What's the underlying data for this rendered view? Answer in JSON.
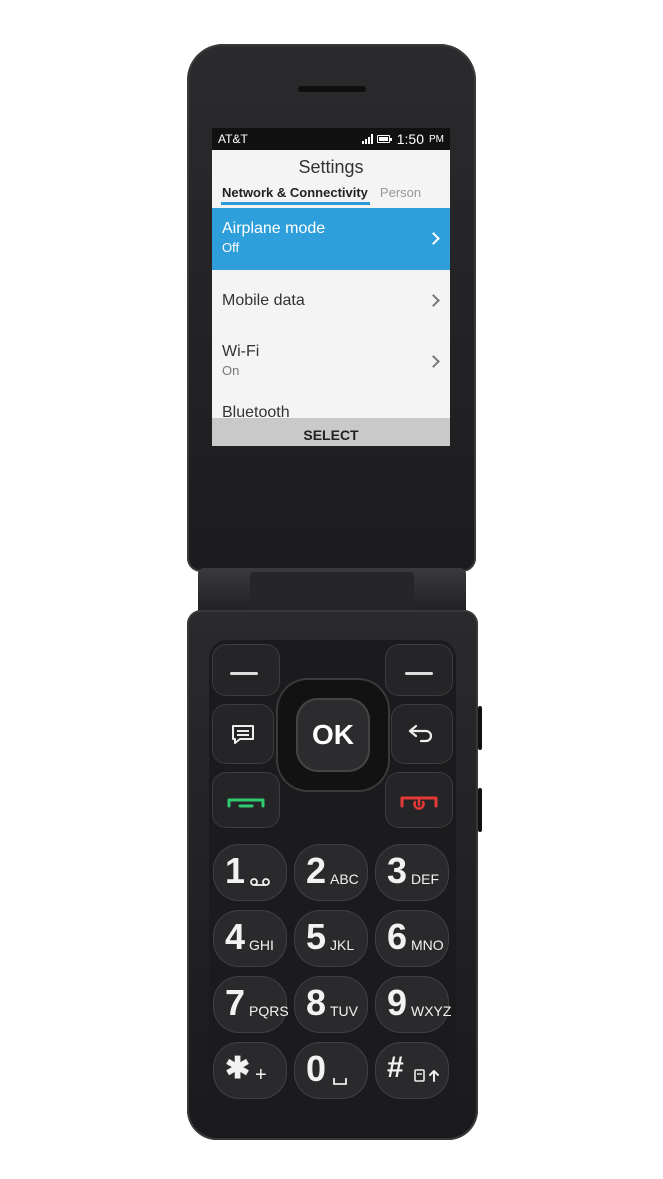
{
  "status_bar": {
    "carrier": "AT&T",
    "time": "1:50",
    "ampm": "PM"
  },
  "screen": {
    "title": "Settings",
    "tabs": [
      "Network & Connectivity",
      "Person"
    ],
    "items": [
      {
        "label": "Airplane mode",
        "sub": "Off",
        "selected": true
      },
      {
        "label": "Mobile data",
        "sub": ""
      },
      {
        "label": "Wi-Fi",
        "sub": "On"
      },
      {
        "label": "Bluetooth",
        "sub": ""
      }
    ],
    "softkey_center": "SELECT"
  },
  "keypad": {
    "ok_label": "OK",
    "keys": [
      {
        "digit": "1",
        "letters": ""
      },
      {
        "digit": "2",
        "letters": "ABC"
      },
      {
        "digit": "3",
        "letters": "DEF"
      },
      {
        "digit": "4",
        "letters": "GHI"
      },
      {
        "digit": "5",
        "letters": "JKL"
      },
      {
        "digit": "6",
        "letters": "MNO"
      },
      {
        "digit": "7",
        "letters": "PQRS"
      },
      {
        "digit": "8",
        "letters": "TUV"
      },
      {
        "digit": "9",
        "letters": "WXYZ"
      },
      {
        "digit": "✱",
        "letters": "+"
      },
      {
        "digit": "0",
        "letters": ""
      },
      {
        "digit": "#",
        "letters": ""
      }
    ]
  },
  "colors": {
    "accent": "#2f9fdc",
    "call_green": "#2ecc71",
    "end_red": "#e53935"
  }
}
